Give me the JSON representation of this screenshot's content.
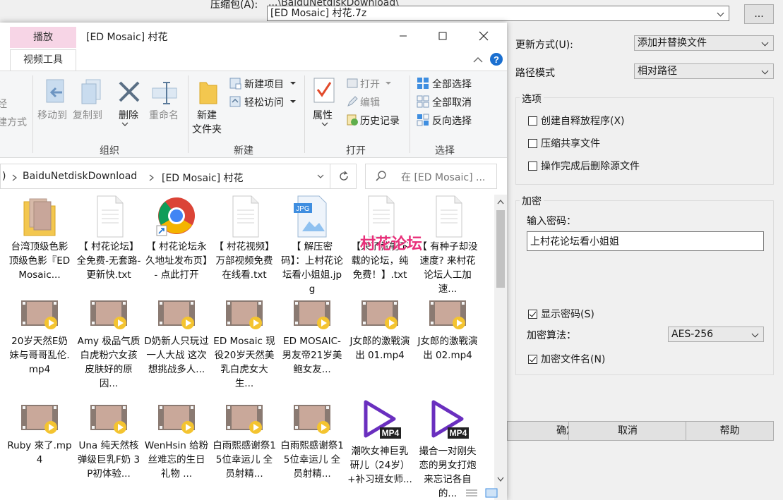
{
  "dialog": {
    "archive_label": "压缩包(A):",
    "archive_path_partial": "...\\BaiduNetdiskDownload\\",
    "archive_value": "[ED Mosaic] 村花.7z",
    "browse_label": "...",
    "update_label": "更新方式(U):",
    "update_value": "添加并替换文件",
    "path_label": "路径模式",
    "path_value": "相对路径",
    "options_title": "选项",
    "opt_sfx": "创建自释放程序(X)",
    "opt_shared": "压缩共享文件",
    "opt_delete": "操作完成后删除源文件",
    "encrypt_title": "加密",
    "password_label": "输入密码：",
    "password_value": "上村花论坛看小姐姐",
    "show_password": "显示密码(S)",
    "algo_label": "加密算法：",
    "algo_value": "AES-256",
    "encrypt_names": "加密文件名(N)",
    "ok": "确定",
    "cancel": "取消",
    "help": "帮助"
  },
  "explorer": {
    "context_tab": "播放",
    "video_tools_tab": "视频工具",
    "title": "[ED Mosaic] 村花",
    "ribbon": {
      "partial1": "经",
      "partial2": "建方式",
      "move_to": "移动到",
      "copy_to": "复制到",
      "delete": "删除",
      "rename": "重命名",
      "group_organize": "组织",
      "new_folder_1": "新建",
      "new_folder_2": "文件夹",
      "new_item": "新建项目",
      "easy_access": "轻松访问",
      "group_new": "新建",
      "properties": "属性",
      "open": "打开",
      "edit": "编辑",
      "history": "历史记录",
      "group_open": "打开",
      "select_all": "全部选择",
      "select_none": "全部取消",
      "invert_selection": "反向选择",
      "group_select": "选择"
    },
    "address": {
      "seg1": "BaiduNetdiskDownload",
      "seg2": "[ED Mosaic] 村花",
      "search_placeholder": "在 [ED Mosaic] ..."
    },
    "files": [
      {
        "name": "台湾顶级色影顶级色影『ED Mosaic...",
        "type": "folder"
      },
      {
        "name": "【 村花论坛】全免费-无套路-更新快.txt",
        "type": "txt"
      },
      {
        "name": "【 村花论坛永久地址发布页】- 点此打开",
        "type": "chrome"
      },
      {
        "name": "【 村花视频】万部视频免费在线看.txt",
        "type": "txt"
      },
      {
        "name": "【 解压密码】：上村花论坛看小姐姐.jpg",
        "type": "jpg"
      },
      {
        "name": "【来了就能下载的论坛，纯免费！】.txt",
        "type": "txt"
      },
      {
        "name": "【 有种子却没速度? 来村花论坛人工加速...",
        "type": "txt"
      },
      {
        "name": "20岁天然E奶妹与哥哥乱伦.mp4",
        "type": "video"
      },
      {
        "name": "Amy 极品气质白虎粉穴女孩皮肤好的原因...",
        "type": "video"
      },
      {
        "name": "D奶新人只玩过一人大战 这次想挑战多人...",
        "type": "video"
      },
      {
        "name": "ED Mosaic 现役20岁天然美乳白虎女大生...",
        "type": "video"
      },
      {
        "name": "ED MOSAIC-男友帝21岁美鲍女友...",
        "type": "video"
      },
      {
        "name": "J女郎的激戰演出 01.mp4",
        "type": "video"
      },
      {
        "name": "J女郎的激戰演出 02.mp4",
        "type": "video"
      },
      {
        "name": "Ruby 來了.mp4",
        "type": "video"
      },
      {
        "name": "Una 纯天然核弹级巨乳F奶 3P初体验...",
        "type": "video"
      },
      {
        "name": "WenHsin 给粉丝难忘的生日礼物 ...",
        "type": "video"
      },
      {
        "name": "白雨熙感谢祭15位幸运儿 全员射精...",
        "type": "video"
      },
      {
        "name": "白雨熙感谢祭15位幸运儿 全员射精...",
        "type": "video"
      },
      {
        "name": "潮吹女神巨乳研儿（24岁）+补习班女师...",
        "type": "mp4"
      },
      {
        "name": "撮合一对刚失恋的男女打炮来忘记各自的...",
        "type": "mp4"
      }
    ],
    "watermark": "村花论坛"
  }
}
